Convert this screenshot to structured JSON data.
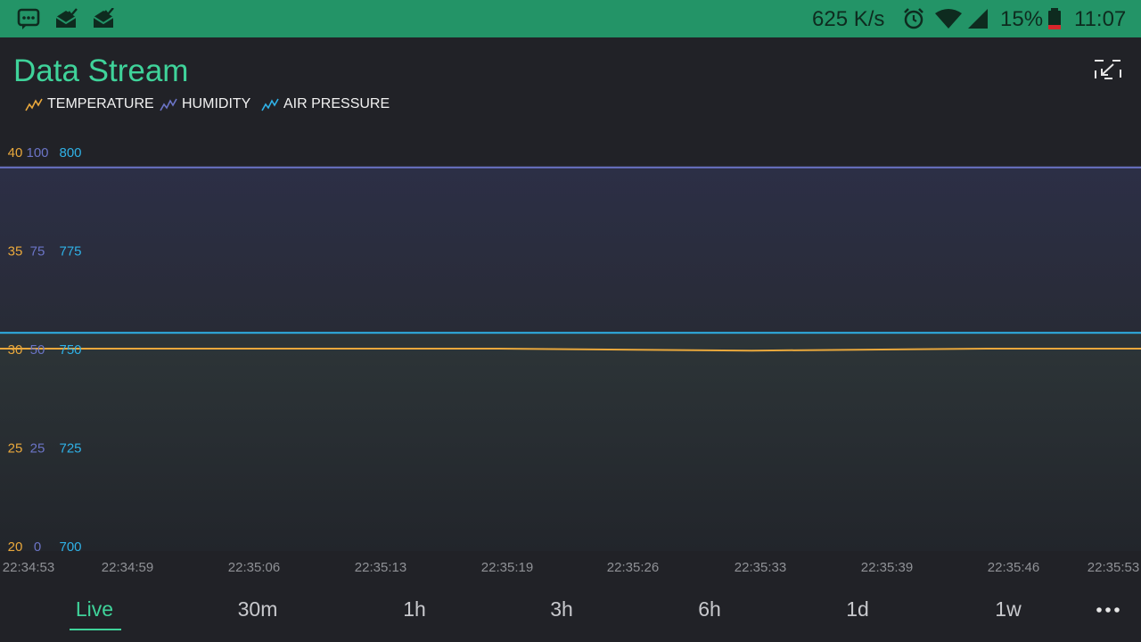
{
  "status_bar": {
    "net_speed": "625 K/s",
    "battery": "15%",
    "time": "11:07",
    "icons": [
      "chat-icon",
      "mail-open-icon",
      "mail-check-icon",
      "alarm-icon",
      "wifi-icon",
      "signal-icon",
      "battery-icon"
    ]
  },
  "header": {
    "title": "Data Stream",
    "expand_icon": "collapse-arrows-icon"
  },
  "legend": [
    {
      "label": "TEMPERATURE",
      "color": "#e9a83c"
    },
    {
      "label": "HUMIDITY",
      "color": "#6b74c6"
    },
    {
      "label": "AIR PRESSURE",
      "color": "#2fb1e6"
    }
  ],
  "chart_data": {
    "type": "line",
    "title": "Data Stream",
    "x_tick_labels": [
      "22:34:53",
      "22:34:59",
      "22:35:06",
      "22:35:13",
      "22:35:19",
      "22:35:26",
      "22:35:33",
      "22:35:39",
      "22:35:46",
      "22:35:53"
    ],
    "x": [
      "22:34:53",
      "22:35:06",
      "22:35:19",
      "22:35:33",
      "22:35:46",
      "22:35:53"
    ],
    "axes": [
      {
        "series": "TEMPERATURE",
        "color": "#e9a83c",
        "range": [
          20,
          40
        ],
        "ticks": [
          40,
          35,
          30,
          25,
          20
        ]
      },
      {
        "series": "HUMIDITY",
        "color": "#6b74c6",
        "range": [
          0,
          100
        ],
        "ticks": [
          100,
          75,
          50,
          25,
          0
        ]
      },
      {
        "series": "AIR PRESSURE",
        "color": "#2fb1e6",
        "range": [
          700,
          800
        ],
        "ticks": [
          800,
          775,
          750,
          725,
          700
        ]
      }
    ],
    "series": [
      {
        "name": "TEMPERATURE",
        "axis": 0,
        "values": [
          30.0,
          30.0,
          30.0,
          29.9,
          30.0,
          30.0
        ]
      },
      {
        "name": "HUMIDITY",
        "axis": 1,
        "values": [
          96,
          96,
          96,
          96,
          96,
          96
        ]
      },
      {
        "name": "AIR PRESSURE",
        "axis": 2,
        "values": [
          754,
          754,
          754,
          754,
          754,
          754
        ]
      }
    ],
    "grid": false,
    "legend_position": "top-left"
  },
  "tabs": [
    {
      "label": "Live",
      "active": true
    },
    {
      "label": "30m",
      "active": false
    },
    {
      "label": "1h",
      "active": false
    },
    {
      "label": "3h",
      "active": false
    },
    {
      "label": "6h",
      "active": false
    },
    {
      "label": "1d",
      "active": false
    },
    {
      "label": "1w",
      "active": false
    }
  ],
  "more_icon": "more-dots-icon",
  "colors": {
    "accent": "#3fd39a",
    "status_bar": "#239467",
    "background": "#212227"
  }
}
